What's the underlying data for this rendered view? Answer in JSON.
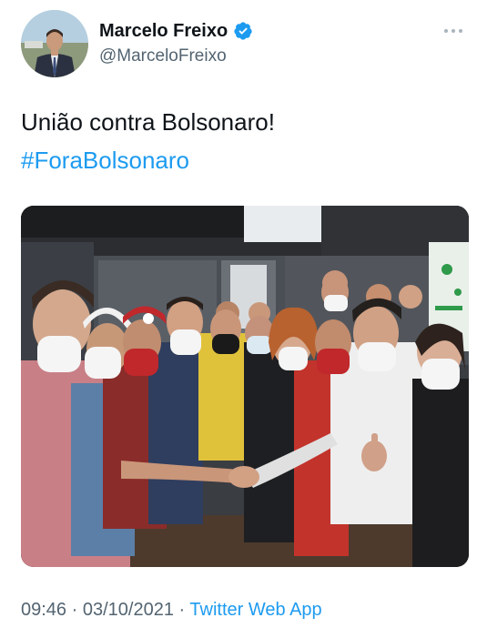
{
  "author": {
    "display_name": "Marcelo Freixo",
    "handle": "@MarceloFreixo",
    "verified": true,
    "avatar_icon": "profile-photo"
  },
  "tweet": {
    "text": "União contra Bolsonaro!",
    "hashtag": "#ForaBolsonaro",
    "media": "group-photo"
  },
  "meta": {
    "time": "09:46",
    "separator": "·",
    "date": "03/10/2021",
    "source": "Twitter Web App"
  },
  "colors": {
    "link": "#1d9bf0",
    "secondary_text": "#536471",
    "primary_text": "#0f1419"
  }
}
